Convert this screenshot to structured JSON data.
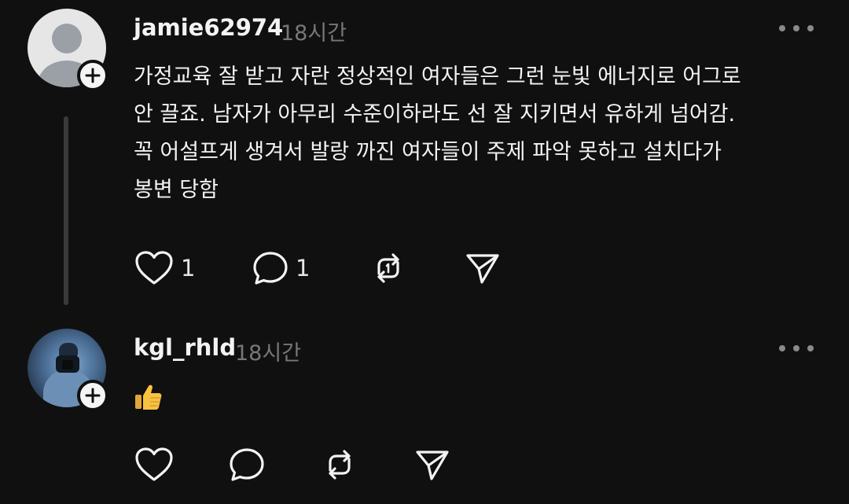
{
  "posts": [
    {
      "username": "jamie62974",
      "time": "18시간",
      "text": "가정교육 잘 받고 자란 정상적인 여자들은 그런 눈빛 에너지로 어그로\n안 끌죠. 남자가 아무리 수준이하라도 선 잘 지키면서 유하게 넘어감.\n꼭 어설프게 생겨서 발랑 까진 여자들이 주제 파악 못하고 설치다가\n봉변 당함",
      "likes": "1",
      "replies": "1",
      "avatar": "default-profile-icon"
    },
    {
      "username": "kgl_rhld",
      "time": "18시간",
      "text": "👍",
      "likes": "",
      "replies": "",
      "avatar": "profile-photo"
    }
  ],
  "colors": {
    "background": "#101010",
    "text": "#f3f3f3",
    "muted": "#777777",
    "thread_line": "#3a3a3a"
  },
  "icons": [
    "heart-icon",
    "comment-icon",
    "repost-icon",
    "share-icon",
    "more-icon",
    "plus-icon"
  ]
}
